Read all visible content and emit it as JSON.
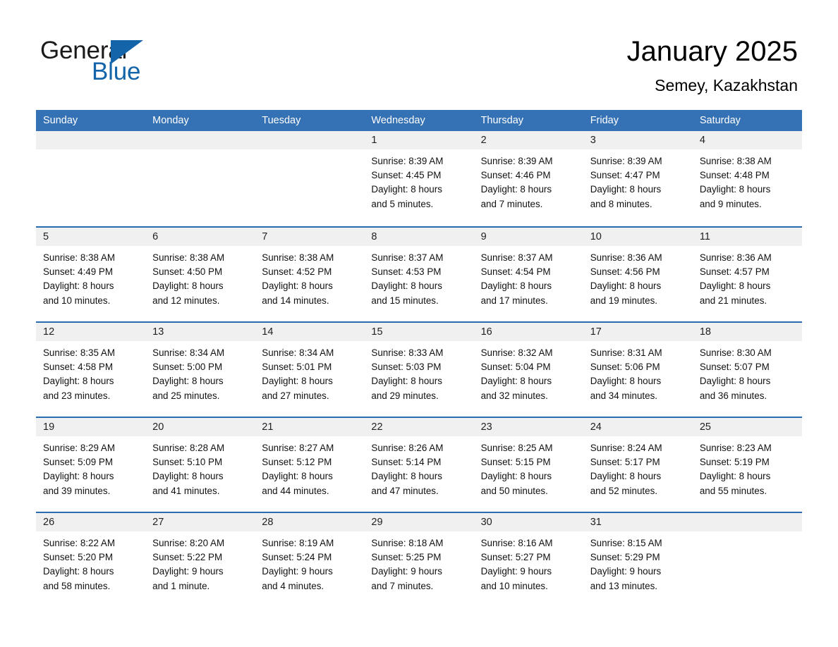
{
  "brand": {
    "name_part1": "General",
    "name_part2": "Blue",
    "accent_color": "#1464aa"
  },
  "header": {
    "title": "January 2025",
    "subtitle": "Semey, Kazakhstan"
  },
  "theme": {
    "header_row_color": "#3571b5",
    "week_divider_color": "#2b6cb0",
    "day_band_color": "#f0f0f0"
  },
  "weekdays": [
    "Sunday",
    "Monday",
    "Tuesday",
    "Wednesday",
    "Thursday",
    "Friday",
    "Saturday"
  ],
  "labels": {
    "sunrise_prefix": "Sunrise:",
    "sunset_prefix": "Sunset:",
    "daylight_prefix": "Daylight:"
  },
  "weeks": [
    {
      "days": [
        {
          "date": "",
          "sunrise": "",
          "sunset": "",
          "daylight_line1": "",
          "daylight_line2": "",
          "empty": true
        },
        {
          "date": "",
          "sunrise": "",
          "sunset": "",
          "daylight_line1": "",
          "daylight_line2": "",
          "empty": true
        },
        {
          "date": "",
          "sunrise": "",
          "sunset": "",
          "daylight_line1": "",
          "daylight_line2": "",
          "empty": true
        },
        {
          "date": "1",
          "sunrise": "Sunrise: 8:39 AM",
          "sunset": "Sunset: 4:45 PM",
          "daylight_line1": "Daylight: 8 hours",
          "daylight_line2": "and 5 minutes.",
          "empty": false
        },
        {
          "date": "2",
          "sunrise": "Sunrise: 8:39 AM",
          "sunset": "Sunset: 4:46 PM",
          "daylight_line1": "Daylight: 8 hours",
          "daylight_line2": "and 7 minutes.",
          "empty": false
        },
        {
          "date": "3",
          "sunrise": "Sunrise: 8:39 AM",
          "sunset": "Sunset: 4:47 PM",
          "daylight_line1": "Daylight: 8 hours",
          "daylight_line2": "and 8 minutes.",
          "empty": false
        },
        {
          "date": "4",
          "sunrise": "Sunrise: 8:38 AM",
          "sunset": "Sunset: 4:48 PM",
          "daylight_line1": "Daylight: 8 hours",
          "daylight_line2": "and 9 minutes.",
          "empty": false
        }
      ]
    },
    {
      "days": [
        {
          "date": "5",
          "sunrise": "Sunrise: 8:38 AM",
          "sunset": "Sunset: 4:49 PM",
          "daylight_line1": "Daylight: 8 hours",
          "daylight_line2": "and 10 minutes.",
          "empty": false
        },
        {
          "date": "6",
          "sunrise": "Sunrise: 8:38 AM",
          "sunset": "Sunset: 4:50 PM",
          "daylight_line1": "Daylight: 8 hours",
          "daylight_line2": "and 12 minutes.",
          "empty": false
        },
        {
          "date": "7",
          "sunrise": "Sunrise: 8:38 AM",
          "sunset": "Sunset: 4:52 PM",
          "daylight_line1": "Daylight: 8 hours",
          "daylight_line2": "and 14 minutes.",
          "empty": false
        },
        {
          "date": "8",
          "sunrise": "Sunrise: 8:37 AM",
          "sunset": "Sunset: 4:53 PM",
          "daylight_line1": "Daylight: 8 hours",
          "daylight_line2": "and 15 minutes.",
          "empty": false
        },
        {
          "date": "9",
          "sunrise": "Sunrise: 8:37 AM",
          "sunset": "Sunset: 4:54 PM",
          "daylight_line1": "Daylight: 8 hours",
          "daylight_line2": "and 17 minutes.",
          "empty": false
        },
        {
          "date": "10",
          "sunrise": "Sunrise: 8:36 AM",
          "sunset": "Sunset: 4:56 PM",
          "daylight_line1": "Daylight: 8 hours",
          "daylight_line2": "and 19 minutes.",
          "empty": false
        },
        {
          "date": "11",
          "sunrise": "Sunrise: 8:36 AM",
          "sunset": "Sunset: 4:57 PM",
          "daylight_line1": "Daylight: 8 hours",
          "daylight_line2": "and 21 minutes.",
          "empty": false
        }
      ]
    },
    {
      "days": [
        {
          "date": "12",
          "sunrise": "Sunrise: 8:35 AM",
          "sunset": "Sunset: 4:58 PM",
          "daylight_line1": "Daylight: 8 hours",
          "daylight_line2": "and 23 minutes.",
          "empty": false
        },
        {
          "date": "13",
          "sunrise": "Sunrise: 8:34 AM",
          "sunset": "Sunset: 5:00 PM",
          "daylight_line1": "Daylight: 8 hours",
          "daylight_line2": "and 25 minutes.",
          "empty": false
        },
        {
          "date": "14",
          "sunrise": "Sunrise: 8:34 AM",
          "sunset": "Sunset: 5:01 PM",
          "daylight_line1": "Daylight: 8 hours",
          "daylight_line2": "and 27 minutes.",
          "empty": false
        },
        {
          "date": "15",
          "sunrise": "Sunrise: 8:33 AM",
          "sunset": "Sunset: 5:03 PM",
          "daylight_line1": "Daylight: 8 hours",
          "daylight_line2": "and 29 minutes.",
          "empty": false
        },
        {
          "date": "16",
          "sunrise": "Sunrise: 8:32 AM",
          "sunset": "Sunset: 5:04 PM",
          "daylight_line1": "Daylight: 8 hours",
          "daylight_line2": "and 32 minutes.",
          "empty": false
        },
        {
          "date": "17",
          "sunrise": "Sunrise: 8:31 AM",
          "sunset": "Sunset: 5:06 PM",
          "daylight_line1": "Daylight: 8 hours",
          "daylight_line2": "and 34 minutes.",
          "empty": false
        },
        {
          "date": "18",
          "sunrise": "Sunrise: 8:30 AM",
          "sunset": "Sunset: 5:07 PM",
          "daylight_line1": "Daylight: 8 hours",
          "daylight_line2": "and 36 minutes.",
          "empty": false
        }
      ]
    },
    {
      "days": [
        {
          "date": "19",
          "sunrise": "Sunrise: 8:29 AM",
          "sunset": "Sunset: 5:09 PM",
          "daylight_line1": "Daylight: 8 hours",
          "daylight_line2": "and 39 minutes.",
          "empty": false
        },
        {
          "date": "20",
          "sunrise": "Sunrise: 8:28 AM",
          "sunset": "Sunset: 5:10 PM",
          "daylight_line1": "Daylight: 8 hours",
          "daylight_line2": "and 41 minutes.",
          "empty": false
        },
        {
          "date": "21",
          "sunrise": "Sunrise: 8:27 AM",
          "sunset": "Sunset: 5:12 PM",
          "daylight_line1": "Daylight: 8 hours",
          "daylight_line2": "and 44 minutes.",
          "empty": false
        },
        {
          "date": "22",
          "sunrise": "Sunrise: 8:26 AM",
          "sunset": "Sunset: 5:14 PM",
          "daylight_line1": "Daylight: 8 hours",
          "daylight_line2": "and 47 minutes.",
          "empty": false
        },
        {
          "date": "23",
          "sunrise": "Sunrise: 8:25 AM",
          "sunset": "Sunset: 5:15 PM",
          "daylight_line1": "Daylight: 8 hours",
          "daylight_line2": "and 50 minutes.",
          "empty": false
        },
        {
          "date": "24",
          "sunrise": "Sunrise: 8:24 AM",
          "sunset": "Sunset: 5:17 PM",
          "daylight_line1": "Daylight: 8 hours",
          "daylight_line2": "and 52 minutes.",
          "empty": false
        },
        {
          "date": "25",
          "sunrise": "Sunrise: 8:23 AM",
          "sunset": "Sunset: 5:19 PM",
          "daylight_line1": "Daylight: 8 hours",
          "daylight_line2": "and 55 minutes.",
          "empty": false
        }
      ]
    },
    {
      "days": [
        {
          "date": "26",
          "sunrise": "Sunrise: 8:22 AM",
          "sunset": "Sunset: 5:20 PM",
          "daylight_line1": "Daylight: 8 hours",
          "daylight_line2": "and 58 minutes.",
          "empty": false
        },
        {
          "date": "27",
          "sunrise": "Sunrise: 8:20 AM",
          "sunset": "Sunset: 5:22 PM",
          "daylight_line1": "Daylight: 9 hours",
          "daylight_line2": "and 1 minute.",
          "empty": false
        },
        {
          "date": "28",
          "sunrise": "Sunrise: 8:19 AM",
          "sunset": "Sunset: 5:24 PM",
          "daylight_line1": "Daylight: 9 hours",
          "daylight_line2": "and 4 minutes.",
          "empty": false
        },
        {
          "date": "29",
          "sunrise": "Sunrise: 8:18 AM",
          "sunset": "Sunset: 5:25 PM",
          "daylight_line1": "Daylight: 9 hours",
          "daylight_line2": "and 7 minutes.",
          "empty": false
        },
        {
          "date": "30",
          "sunrise": "Sunrise: 8:16 AM",
          "sunset": "Sunset: 5:27 PM",
          "daylight_line1": "Daylight: 9 hours",
          "daylight_line2": "and 10 minutes.",
          "empty": false
        },
        {
          "date": "31",
          "sunrise": "Sunrise: 8:15 AM",
          "sunset": "Sunset: 5:29 PM",
          "daylight_line1": "Daylight: 9 hours",
          "daylight_line2": "and 13 minutes.",
          "empty": false
        },
        {
          "date": "",
          "sunrise": "",
          "sunset": "",
          "daylight_line1": "",
          "daylight_line2": "",
          "empty": true
        }
      ]
    }
  ]
}
